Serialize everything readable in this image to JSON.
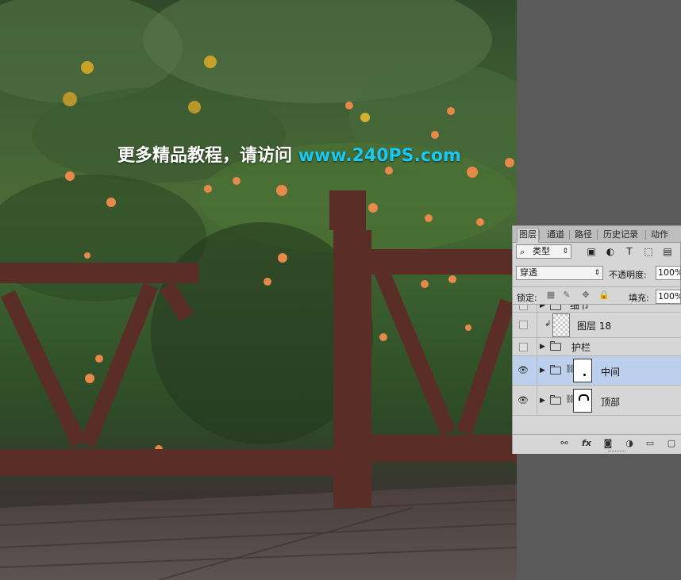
{
  "watermark": {
    "text_cn": "更多精品教程，请访问",
    "url": "www.240PS.com"
  },
  "panel": {
    "tabs": [
      "图层",
      "通道",
      "路径",
      "历史记录",
      "动作"
    ],
    "active_tab": "图层",
    "kind_filter": "类型",
    "blend_mode": "穿透",
    "opacity_label": "不透明度:",
    "opacity_value": "100%",
    "lock_label": "锁定:",
    "fill_label": "填充:",
    "fill_value": "100%",
    "layers": [
      {
        "name": "细节",
        "type": "group",
        "visible": false,
        "selected": false
      },
      {
        "name": "图层 18",
        "type": "pixel",
        "visible": false,
        "selected": false,
        "clipped": true
      },
      {
        "name": "护栏",
        "type": "group",
        "visible": false,
        "selected": false
      },
      {
        "name": "中间",
        "type": "group-mask",
        "visible": true,
        "selected": true
      },
      {
        "name": "顶部",
        "type": "group-mask",
        "visible": true,
        "selected": false
      }
    ],
    "footer_icons": [
      "link-icon",
      "fx-icon",
      "mask-icon",
      "adjustment-icon",
      "new-group-icon",
      "new-layer-icon"
    ]
  },
  "colors": {
    "selection": "#bcd0ee",
    "panel_bg": "#d6d6d6",
    "watermark_url": "#19c8f0"
  }
}
